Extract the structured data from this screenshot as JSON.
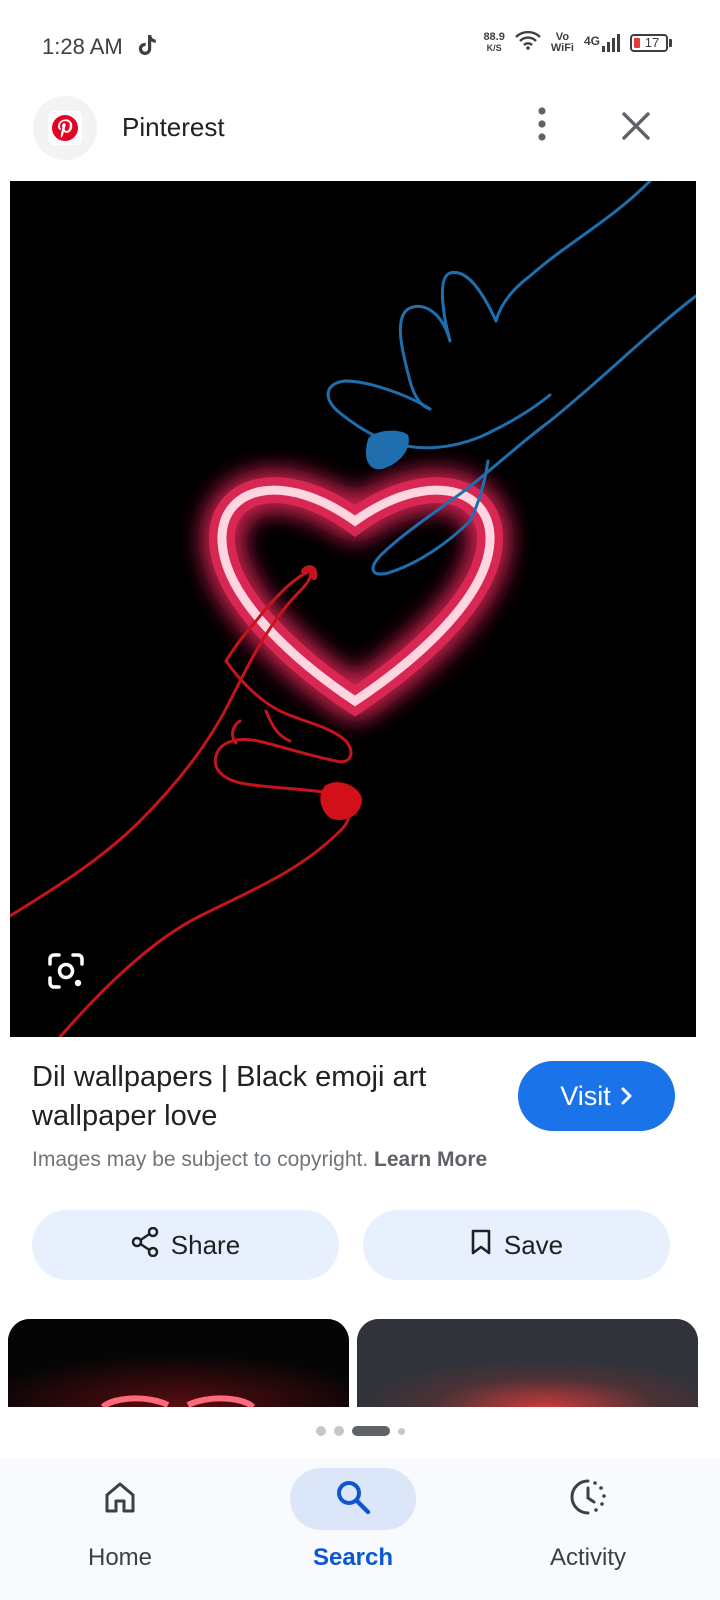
{
  "status_bar": {
    "time": "1:28 AM",
    "net_speed_value": "88.9",
    "net_speed_unit": "K/S",
    "vo_label": "Vo",
    "wifi_label": "WiFi",
    "network_type": "4G",
    "battery_level": "17"
  },
  "header": {
    "site_name": "Pinterest",
    "logo_icon": "pinterest-logo",
    "more_icon": "more-vert-icon",
    "close_icon": "close-icon"
  },
  "result": {
    "title": "Dil wallpapers | Black emoji art wallpaper love",
    "copyright_text": "Images may be subject to copyright.",
    "learn_more": "Learn More",
    "visit_label": "Visit"
  },
  "actions": {
    "share_label": "Share",
    "save_label": "Save"
  },
  "carousel": {
    "page_count": 4,
    "active_index": 2
  },
  "bottom_nav": {
    "items": [
      {
        "label": "Home",
        "icon": "home-icon"
      },
      {
        "label": "Search",
        "icon": "search-icon",
        "active": true
      },
      {
        "label": "Activity",
        "icon": "activity-icon"
      }
    ]
  },
  "colors": {
    "accent": "#1a73e8",
    "pill_bg": "#e8f0fe",
    "pinterest_red": "#e60023",
    "neon_pink": "#ff2e63",
    "hand_blue": "#1f6fae",
    "hand_red": "#c4141c"
  }
}
